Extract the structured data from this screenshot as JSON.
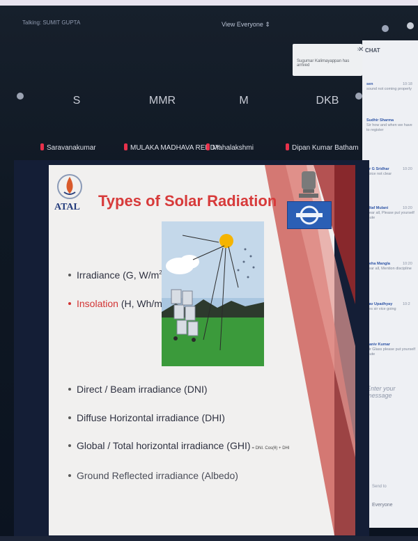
{
  "meeting": {
    "talking": "Talking: SUMIT GUPTA",
    "view": "View Everyone"
  },
  "participants": [
    {
      "initials": "S",
      "name": "Saravanakumar"
    },
    {
      "initials": "MMR",
      "name": "MULAKA MADHAVA REDDY"
    },
    {
      "initials": "M",
      "name": "Mahalakshmi"
    },
    {
      "initials": "DKB",
      "name": "Dipan Kumar Batham"
    }
  ],
  "notification": "Sugumar Kalimayappan has arrived",
  "chat": {
    "title": "CHAT",
    "messages": [
      {
        "who": "sen",
        "time": "10:18",
        "text": "sound not coming properly"
      },
      {
        "who": "Sudhir Sharma",
        "time": "",
        "text": "Sir how and when we have to register"
      },
      {
        "who": "Dr G Sridhar",
        "time": "10:20",
        "text": "Voice not clear"
      },
      {
        "who": "Altaf Mulani",
        "time": "10:20",
        "text": "Dear all, Please put yourself mute"
      },
      {
        "who": "Neha Mangla",
        "time": "10:20",
        "text": "dear all, Mention discipline"
      },
      {
        "who": "Lav Upadhyay",
        "time": "10:2",
        "text": "Yes sir vice going"
      },
      {
        "who": "Daniv Kumar",
        "time": "",
        "text": "Sir Glass please put yourself mute"
      }
    ],
    "input_placeholder": "Enter your message",
    "send_to_label": "Send to",
    "send_to_value": "Everyone"
  },
  "slide": {
    "logo_text": "ATAL",
    "title": "Types of Solar Radiation",
    "bullets": [
      {
        "main": "Irradiance (G, W/m",
        "sup": "2",
        "end": ")"
      },
      {
        "red": "Insolation",
        "main": " (H, Wh/m",
        "sup": "2",
        "end": ")"
      }
    ],
    "bullets2": [
      {
        "text": "Direct / Beam irradiance (DNI)"
      },
      {
        "text": "Diffuse Horizontal irradiance (DHI)"
      },
      {
        "text": "Global / Total horizontal irradiance (GHI)",
        "note": "= DNI. Cos(θ) + DHI"
      },
      {
        "text": "Ground Reflected irradiance (Albedo)"
      }
    ]
  },
  "colors": {
    "accent_red": "#d73a3a",
    "atal_blue": "#243c7c",
    "chat_link": "#2f55a6"
  }
}
